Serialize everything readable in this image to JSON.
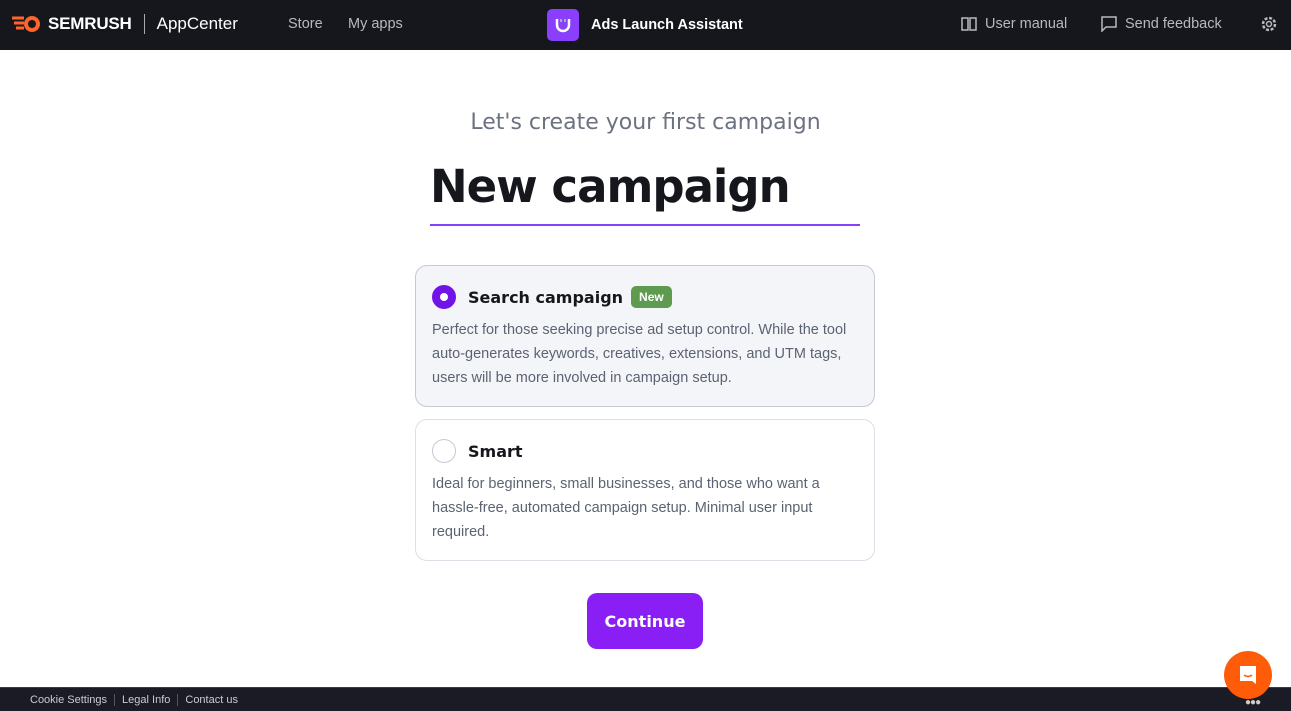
{
  "topbar": {
    "brand": "SEMRUSH",
    "product": "AppCenter",
    "nav": [
      "Store",
      "My apps"
    ],
    "app_name": "Ads Launch Assistant",
    "user_manual": "User manual",
    "send_feedback": "Send feedback"
  },
  "main": {
    "subtitle": "Let's create your first campaign",
    "campaign_name": "New campaign",
    "options": [
      {
        "title": "Search campaign",
        "badge": "New",
        "selected": true,
        "description": "Perfect for those seeking precise ad setup control. While the tool auto-generates keywords, creatives, extensions, and UTM tags, users will be more involved in campaign setup."
      },
      {
        "title": "Smart",
        "selected": false,
        "description": "Ideal for beginners, small businesses, and those who want a hassle-free, automated campaign setup. Minimal user input required."
      }
    ],
    "continue": "Continue"
  },
  "footer": {
    "links": [
      "Cookie Settings",
      "Legal Info",
      "Contact us"
    ]
  },
  "colors": {
    "accent": "#8a1ff5",
    "brand_orange": "#ff5c0a",
    "badge_green": "#5e9a4f",
    "topbar": "#16171c"
  }
}
